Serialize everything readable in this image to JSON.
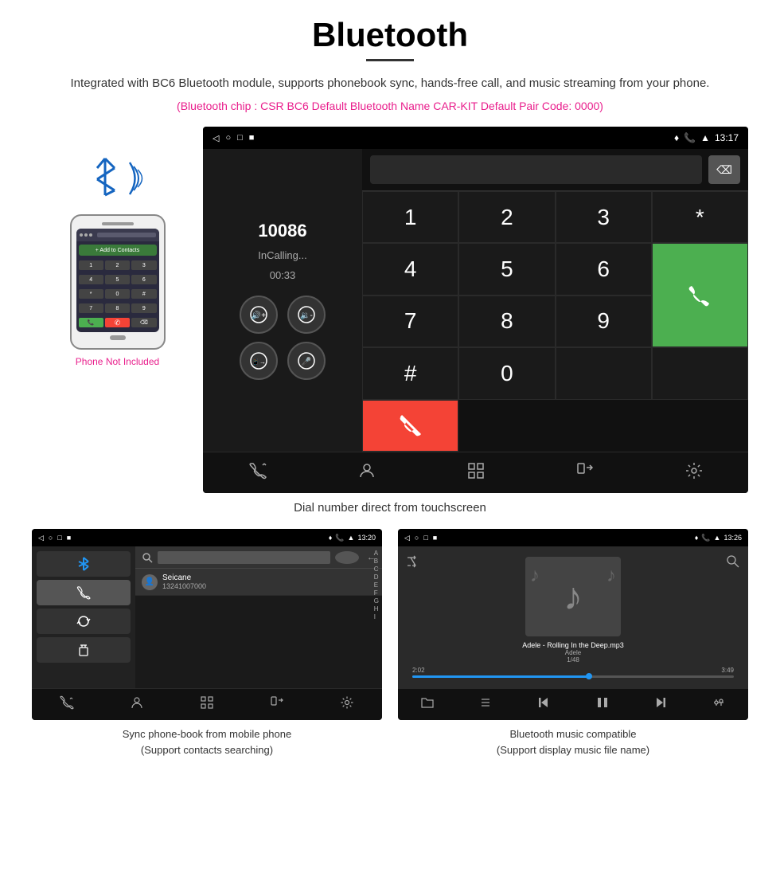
{
  "page": {
    "title": "Bluetooth",
    "subtitle": "Integrated with BC6 Bluetooth module, supports phonebook sync, hands-free call, and music streaming from your phone.",
    "specs": "(Bluetooth chip : CSR BC6    Default Bluetooth Name CAR-KIT    Default Pair Code: 0000)"
  },
  "phone_illustration": {
    "label": "Phone Not Included",
    "add_contact_text": "+ Add to Contacts"
  },
  "car_display": {
    "status_bar": {
      "time": "13:17",
      "left_icons": [
        "◁",
        "○",
        "□",
        "■"
      ]
    },
    "caller": {
      "number": "10086",
      "status": "InCalling...",
      "timer": "00:33"
    },
    "dialer_keys": [
      "1",
      "2",
      "3",
      "*",
      "4",
      "5",
      "6",
      "0",
      "7",
      "8",
      "9",
      "#"
    ]
  },
  "main_caption": "Dial number direct from touchscreen",
  "phonebook_screen": {
    "status_time": "13:20",
    "contact_name": "Seicane",
    "contact_phone": "13241007000",
    "index_letters": [
      "A",
      "B",
      "C",
      "D",
      "E",
      "F",
      "G",
      "H",
      "I"
    ]
  },
  "music_screen": {
    "status_time": "13:26",
    "track_name": "Adele - Rolling In the Deep.mp3",
    "artist": "Adele",
    "track_num": "1/48",
    "time_current": "2:02",
    "time_total": "3:49",
    "progress_percent": 55
  },
  "captions": {
    "phonebook": "Sync phone-book from mobile phone\n(Support contacts searching)",
    "music": "Bluetooth music compatible\n(Support display music file name)"
  },
  "colors": {
    "accent_pink": "#e91e8c",
    "green": "#4caf50",
    "red": "#f44336",
    "blue": "#2196f3"
  }
}
